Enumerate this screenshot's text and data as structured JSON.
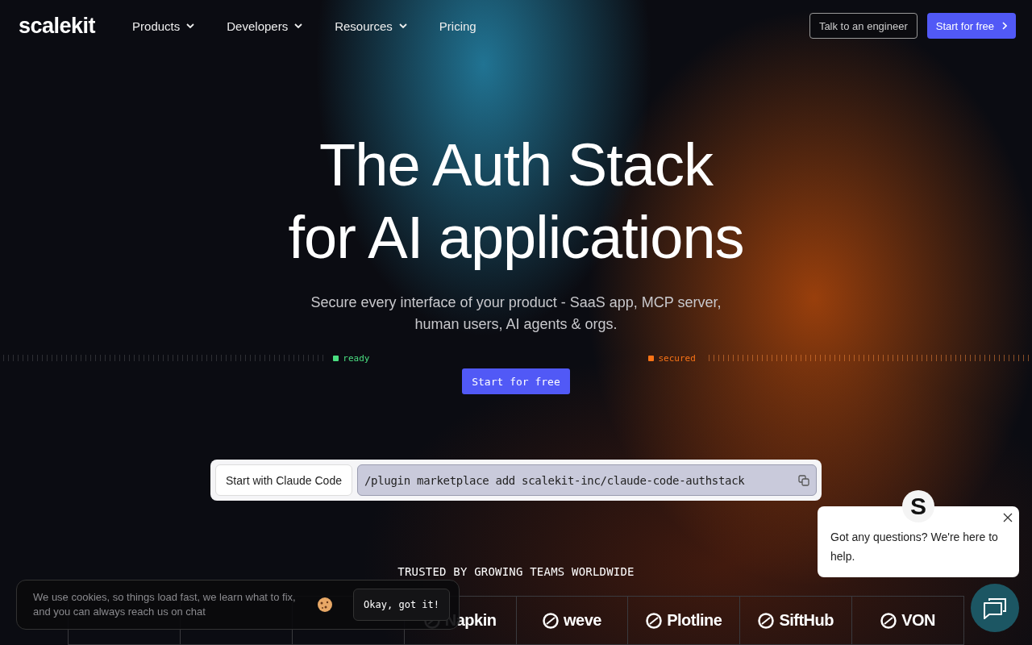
{
  "nav": {
    "logo": "scalekit",
    "items": [
      {
        "label": "Products",
        "has_menu": true
      },
      {
        "label": "Developers",
        "has_menu": true
      },
      {
        "label": "Resources",
        "has_menu": true
      },
      {
        "label": "Pricing",
        "has_menu": false
      }
    ],
    "buttons": [
      {
        "label": "Talk to an engineer",
        "kind": "outline"
      },
      {
        "label": "Start for free",
        "kind": "primary"
      }
    ]
  },
  "hero": {
    "title_lines": [
      "The Auth Stack",
      "for AI applications"
    ],
    "subtitle": "Secure every interface of your product - SaaS app, MCP server, human users, AI agents & orgs.",
    "statuses": [
      {
        "label": "ready",
        "color": "#4ade80"
      },
      {
        "label": "secured",
        "color": "#f97316"
      }
    ],
    "cta": "Start for free"
  },
  "command": {
    "tab": "Start with Claude Code",
    "value": "/plugin marketplace add scalekit-inc/claude-code-authstack"
  },
  "trusted": {
    "heading": "TRUSTED BY GROWING TEAMS WORLDWIDE",
    "logos": [
      {
        "name": "Napkin",
        "kind": "mark"
      },
      {
        "name": "weve",
        "kind": "mark"
      },
      {
        "name": "Plotline",
        "kind": "mark"
      },
      {
        "name": "SiftHub",
        "kind": "mark"
      },
      {
        "name": "VON",
        "kind": "mark"
      }
    ]
  },
  "cookie_banner": {
    "text": "We use cookies, so things load fast, we learn what to fix, and you can always reach us on chat",
    "button": "Okay, got it!"
  },
  "chat": {
    "avatar": "S",
    "message": "Got any questions? We're here to help."
  }
}
